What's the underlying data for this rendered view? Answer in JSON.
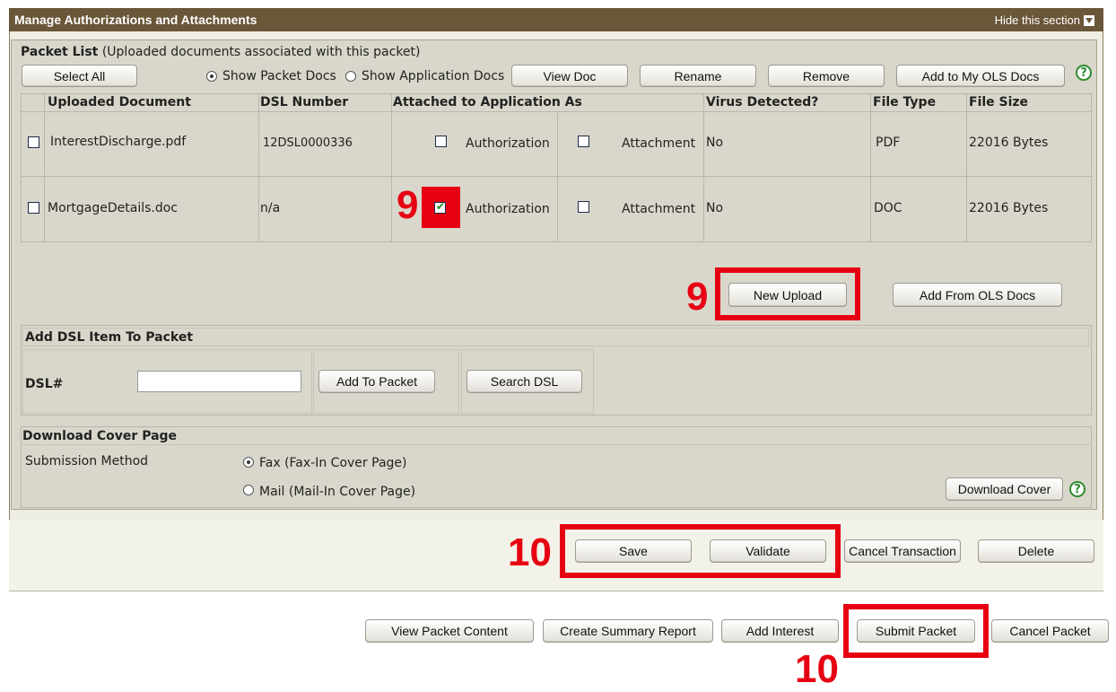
{
  "section": {
    "title": "Manage Authorizations and Attachments",
    "hide_label": "Hide this section"
  },
  "packet_list": {
    "heading": "Packet List",
    "subtitle": "(Uploaded documents associated with this packet)",
    "select_all": "Select All",
    "show_packet_docs": "Show Packet Docs",
    "show_application_docs": "Show Application Docs",
    "view_doc": "View Doc",
    "rename": "Rename",
    "remove": "Remove",
    "add_to_my_ols_docs": "Add to My OLS Docs",
    "columns": [
      "Uploaded Document",
      "DSL Number",
      "Attached to Application As",
      "Virus Detected?",
      "File Type",
      "File Size"
    ],
    "rows": [
      {
        "name": "InterestDischarge.pdf",
        "dsl": "12DSL0000336",
        "auth": "Authorization",
        "attach": "Attachment",
        "virus": "No",
        "type": "PDF",
        "size": "22016 Bytes"
      },
      {
        "name": "MortgageDetails.doc",
        "dsl": "n/a",
        "auth": "Authorization",
        "attach": "Attachment",
        "virus": "No",
        "type": "DOC",
        "size": "22016 Bytes"
      }
    ],
    "new_upload": "New Upload",
    "add_from_ols": "Add From OLS Docs"
  },
  "dsl_item": {
    "heading": "Add DSL Item To Packet",
    "label": "DSL#",
    "add_to_packet": "Add To Packet",
    "search_dsl": "Search DSL"
  },
  "cover": {
    "heading": "Download Cover Page",
    "method_label": "Submission Method",
    "fax": "Fax (Fax-In Cover Page)",
    "mail": "Mail (Mail-In Cover Page)",
    "download": "Download Cover"
  },
  "actions": {
    "save": "Save",
    "validate": "Validate",
    "cancel_transaction": "Cancel Transaction",
    "delete": "Delete"
  },
  "bottom": {
    "view_packet_content": "View Packet Content",
    "create_summary_report": "Create Summary Report",
    "add_interest": "Add Interest",
    "submit_packet": "Submit Packet",
    "cancel_packet": "Cancel Packet"
  },
  "annotations": {
    "step9": "9",
    "step10": "10"
  },
  "colors": {
    "header": "#6a5638",
    "highlight": "#e60012"
  }
}
